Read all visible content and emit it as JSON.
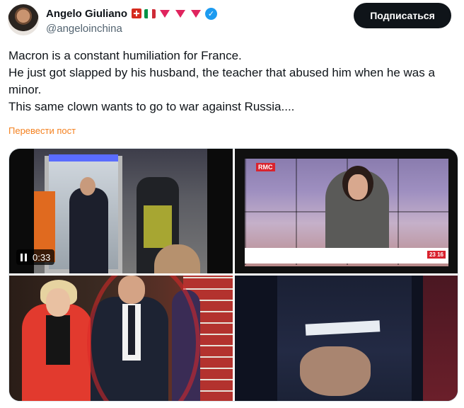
{
  "author": {
    "name": "Angelo Giuliano",
    "handle": "@angeloinchina",
    "badges": [
      "swiss-flag-icon",
      "italian-flag-icon",
      "red-triangle-icon",
      "red-triangle-icon",
      "red-triangle-icon",
      "verified-icon"
    ]
  },
  "follow_button": {
    "label": "Подписаться"
  },
  "tweet": {
    "lines": [
      "Macron is a constant humiliation for France.",
      "He just got slapped by his husband, the teacher that abused him when he was a minor.",
      "This same clown wants to go to war against Russia...."
    ],
    "translate_label": "Перевести пост"
  },
  "media": {
    "video": {
      "duration": "0:33"
    },
    "tv": {
      "channel": "RMC",
      "clock": "23 16"
    }
  },
  "colors": {
    "accent": "#1d9bf0",
    "translate": "#f4811f",
    "button_bg": "#0f1419"
  }
}
